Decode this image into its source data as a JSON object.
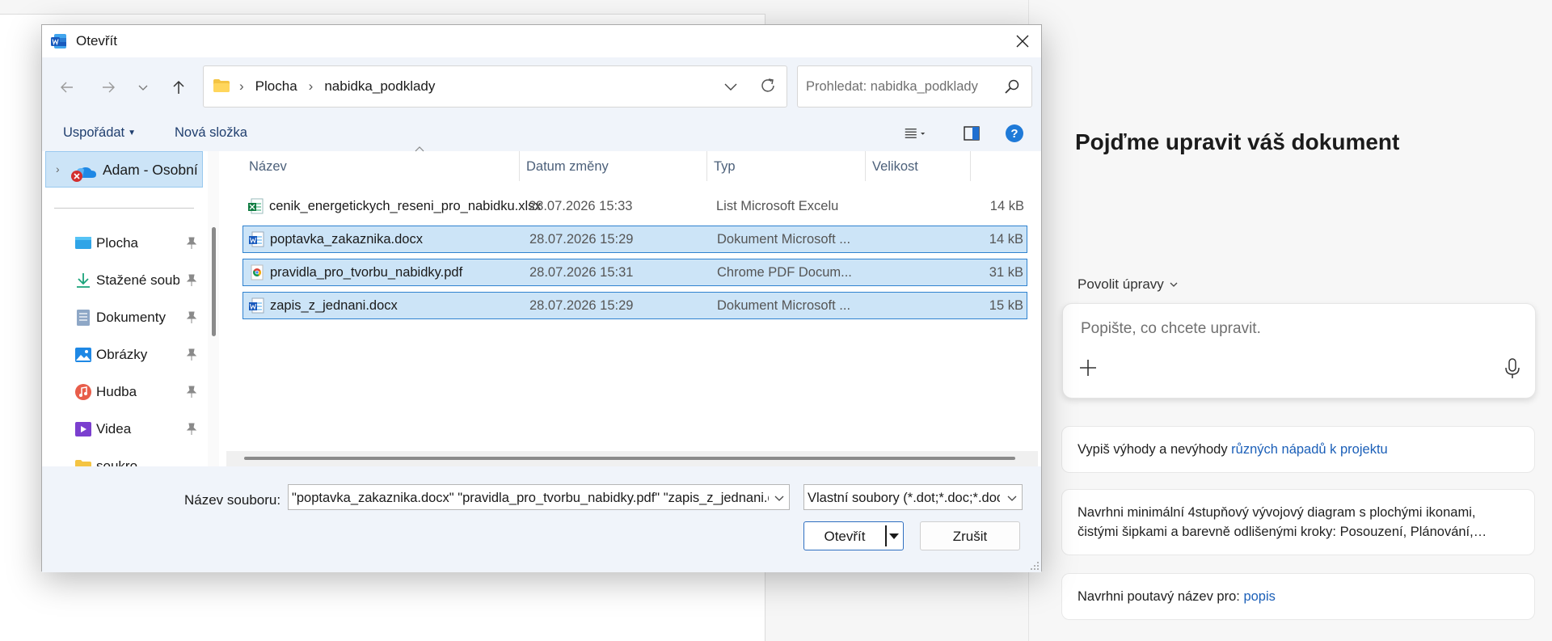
{
  "background": {
    "copilot": {
      "title": "Pojďme upravit váš dokument",
      "mode": "Povolit úpravy",
      "input_placeholder": "Popište, co chcete upravit.",
      "suggestions": [
        {
          "text": "Vypiš výhody a nevýhody ",
          "highlight": "různých nápadů k projektu"
        },
        {
          "text": "Navrhni minimální 4stupňový vývojový diagram s plochými ikonami, čistými šipkami a barevně odlišenými kroky: Posouzení, Plánování,…",
          "highlight": ""
        },
        {
          "text": "Navrhni poutavý název pro: ",
          "highlight": "popis"
        }
      ]
    }
  },
  "dialog": {
    "title": "Otevřít",
    "address": {
      "crumbs": [
        "Plocha",
        "nabidka_podklady"
      ]
    },
    "search_placeholder": "Prohledat: nabidka_podklady",
    "toolbar": {
      "organize": "Uspořádat",
      "new_folder": "Nová složka"
    },
    "sidebar": {
      "top_item": "Adam - Osobní",
      "items": [
        {
          "label": "Plocha",
          "icon": "desktop-icon"
        },
        {
          "label": "Stažené soubory",
          "icon": "download-icon"
        },
        {
          "label": "Dokumenty",
          "icon": "documents-icon"
        },
        {
          "label": "Obrázky",
          "icon": "pictures-icon"
        },
        {
          "label": "Hudba",
          "icon": "music-icon"
        },
        {
          "label": "Videa",
          "icon": "videos-icon"
        },
        {
          "label": "soukro",
          "icon": "folder-icon"
        }
      ]
    },
    "columns": {
      "name": "Název",
      "date": "Datum změny",
      "type": "Typ",
      "size": "Velikost"
    },
    "files": [
      {
        "name": "cenik_energetickych_reseni_pro_nabidku.xlsx",
        "date": "28.07.2026 15:33",
        "type": "List Microsoft Excelu",
        "size": "14 kB",
        "icon": "excel-file-icon",
        "selected": false
      },
      {
        "name": "poptavka_zakaznika.docx",
        "date": "28.07.2026 15:29",
        "type": "Dokument Microsoft ...",
        "size": "14 kB",
        "icon": "word-file-icon",
        "selected": true
      },
      {
        "name": "pravidla_pro_tvorbu_nabidky.pdf",
        "date": "28.07.2026 15:31",
        "type": "Chrome PDF Docum...",
        "size": "31 kB",
        "icon": "pdf-file-icon",
        "selected": true
      },
      {
        "name": "zapis_z_jednani.docx",
        "date": "28.07.2026 15:29",
        "type": "Dokument Microsoft ...",
        "size": "15 kB",
        "icon": "word-file-icon",
        "selected": true
      }
    ],
    "filename_label": "Název souboru:",
    "filename_value": "\"poptavka_zakaznika.docx\" \"pravidla_pro_tvorbu_nabidky.pdf\" \"zapis_z_jednani.docx\"",
    "filetype_value": "Vlastní soubory (*.dot;*.doc;*.docx)",
    "open_button": "Otevřít",
    "cancel_button": "Zrušit"
  }
}
